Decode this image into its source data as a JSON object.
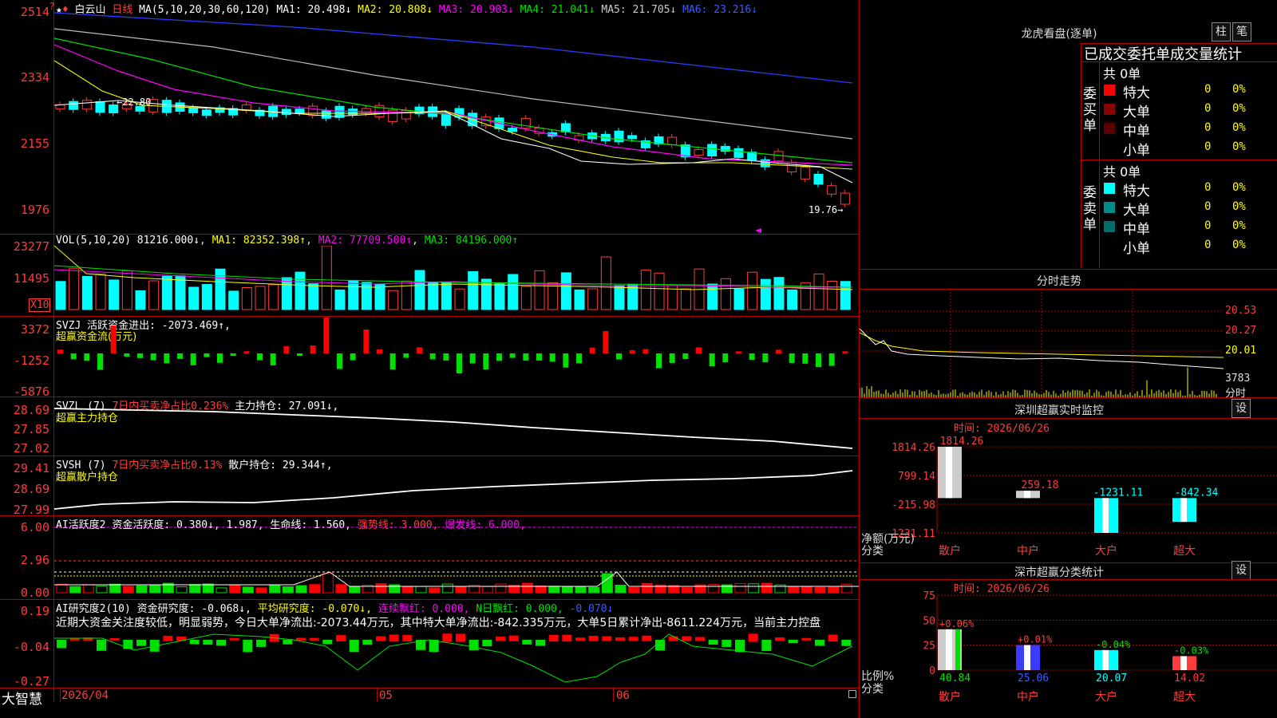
{
  "header": {
    "stock_name": "白云山",
    "period": "日线",
    "ma_spec": "MA(5,10,20,30,60,120)",
    "ma": [
      {
        "label": "MA1:",
        "value": "20.498↓",
        "color": "#ffffff"
      },
      {
        "label": "MA2:",
        "value": "20.808↓",
        "color": "#ffff00"
      },
      {
        "label": "MA3:",
        "value": "20.903↓",
        "color": "#ff00ff"
      },
      {
        "label": "MA4:",
        "value": "21.041↓",
        "color": "#00e000"
      },
      {
        "label": "MA5:",
        "value": "21.705↓",
        "color": "#cccccc"
      },
      {
        "label": "MA6:",
        "value": "23.216↓",
        "color": "#3b5bff"
      }
    ]
  },
  "price_axis": [
    "2514",
    "2334",
    "2155",
    "1976"
  ],
  "price_annotations": {
    "high": "22.80",
    "low": "19.76"
  },
  "vol": {
    "label": "VOL(5,10,20)",
    "value": "81216.000↓",
    "ma1": "MA1: 82352.398↑",
    "ma2": "MA2: 77709.500↑",
    "ma3": "MA3: 84196.000↑",
    "axis": [
      "23277",
      "11495"
    ],
    "unit": "X10"
  },
  "svzj": {
    "label": "SVZJ",
    "text": "活跃资金进出: -2073.469↑,",
    "sub": "超赢资金流(万元)",
    "axis": [
      "3372",
      "-1252",
      "-5876"
    ]
  },
  "svzl": {
    "label": "SVZL (7)",
    "text1": "7日内买卖净占比0.236%",
    "text2": "主力持仓: 27.091↓,",
    "sub": "超赢主力持仓",
    "axis": [
      "28.69",
      "27.85",
      "27.02"
    ]
  },
  "svsh": {
    "label": "SVSH (7)",
    "text1": "7日内买卖净占比0.13%",
    "text2": "散户持仓: 29.344↑,",
    "sub": "超赢散户持仓",
    "axis": [
      "29.41",
      "28.69",
      "27.99"
    ]
  },
  "ai_active": {
    "label": "AI活跃度2",
    "t1": "资金活跃度: 0.380↓,",
    "t2": "1.987,",
    "t3": "生命线: 1.560,",
    "t4": "强势线: 3.000,",
    "t5": "爆发线: 6.000,",
    "axis": [
      "6.00",
      "2.96",
      "0.00"
    ]
  },
  "ai_research": {
    "label": "AI研究度2(10)",
    "t1": "资金研究度: -0.068↓,",
    "t2": "平均研究度: -0.070↓,",
    "t3": "连续飘红: 0.000,",
    "t4": "N日飘红: 0.000,",
    "t5": "-0.070↓",
    "comment": "近期大资金关注度较低，明显弱势，今日大单净流出:-2073.44万元，其中特大单净流出:-842.335万元，大单5日累计净出-8611.224万元，当前主力控盘",
    "axis": [
      "0.19",
      "-0.04",
      "-0.27"
    ]
  },
  "bottom_bar": {
    "brand": "大智慧",
    "dates": [
      "2026/04",
      "05",
      "06"
    ]
  },
  "longhu": {
    "title": "龙虎看盘(逐单)",
    "btn1": "柱",
    "btn2": "笔",
    "tabs": "已成交委托单成交量统计",
    "buy_label": "委买单",
    "sell_label": "委卖单",
    "buy_total": "共 0单",
    "sell_total": "共 0单",
    "buy_rows": [
      {
        "name": "特大",
        "count": "0",
        "pct": "0%",
        "color": "#ff0000"
      },
      {
        "name": "大单",
        "count": "0",
        "pct": "0%",
        "color": "#8b0000"
      },
      {
        "name": "中单",
        "count": "0",
        "pct": "0%",
        "color": "#5a0000"
      },
      {
        "name": "小单",
        "count": "0",
        "pct": "0%",
        "color": ""
      }
    ],
    "sell_rows": [
      {
        "name": "特大",
        "count": "0",
        "pct": "0%",
        "color": "#00ffff"
      },
      {
        "name": "大单",
        "count": "0",
        "pct": "0%",
        "color": "#008b8b"
      },
      {
        "name": "中单",
        "count": "0",
        "pct": "0%",
        "color": "#006b6b"
      },
      {
        "name": "小单",
        "count": "0",
        "pct": "0%",
        "color": ""
      }
    ]
  },
  "intraday": {
    "title": "分时走势",
    "axis": [
      "20.53",
      "20.27",
      "20.01",
      "3783"
    ],
    "unit": "分时"
  },
  "monitor": {
    "title": "深圳超赢实时监控",
    "btn": "设",
    "time": "时间: 2026/06/26",
    "axis": [
      "1814.26",
      "799.14",
      "-215.98",
      "-1231.11"
    ],
    "ylabel": "净额(万元)",
    "xlabel": "分类",
    "categories": [
      "散户",
      "中户",
      "大户",
      "超大"
    ],
    "values": [
      "1814.26",
      "259.18",
      "-1231.11",
      "-842.34"
    ]
  },
  "classify": {
    "title": "深市超赢分类统计",
    "btn": "设",
    "time": "时间: 2026/06/26",
    "axis": [
      "75",
      "50",
      "25",
      "0"
    ],
    "ylabel": "比例%",
    "xlabel": "分类",
    "categories": [
      "散户",
      "中户",
      "大户",
      "超大"
    ],
    "changes": [
      "+0.06%",
      "+0.01%",
      "-0.04%",
      "-0.03%"
    ],
    "values": [
      "40.84",
      "25.06",
      "20.07",
      "14.02"
    ]
  },
  "chart_data": [
    {
      "type": "bar",
      "title": "深圳超赢实时监控",
      "categories": [
        "散户",
        "中户",
        "大户",
        "超大"
      ],
      "values": [
        1814.26,
        259.18,
        -1231.11,
        -842.34
      ],
      "ylabel": "净额(万元)",
      "xlabel": "分类",
      "ylim": [
        -1231.11,
        1814.26
      ]
    },
    {
      "type": "bar",
      "title": "深市超赢分类统计",
      "categories": [
        "散户",
        "中户",
        "大户",
        "超大"
      ],
      "values": [
        40.84,
        25.06,
        20.07,
        14.02
      ],
      "ylabel": "比例%",
      "xlabel": "分类",
      "ylim": [
        0,
        75
      ]
    }
  ]
}
